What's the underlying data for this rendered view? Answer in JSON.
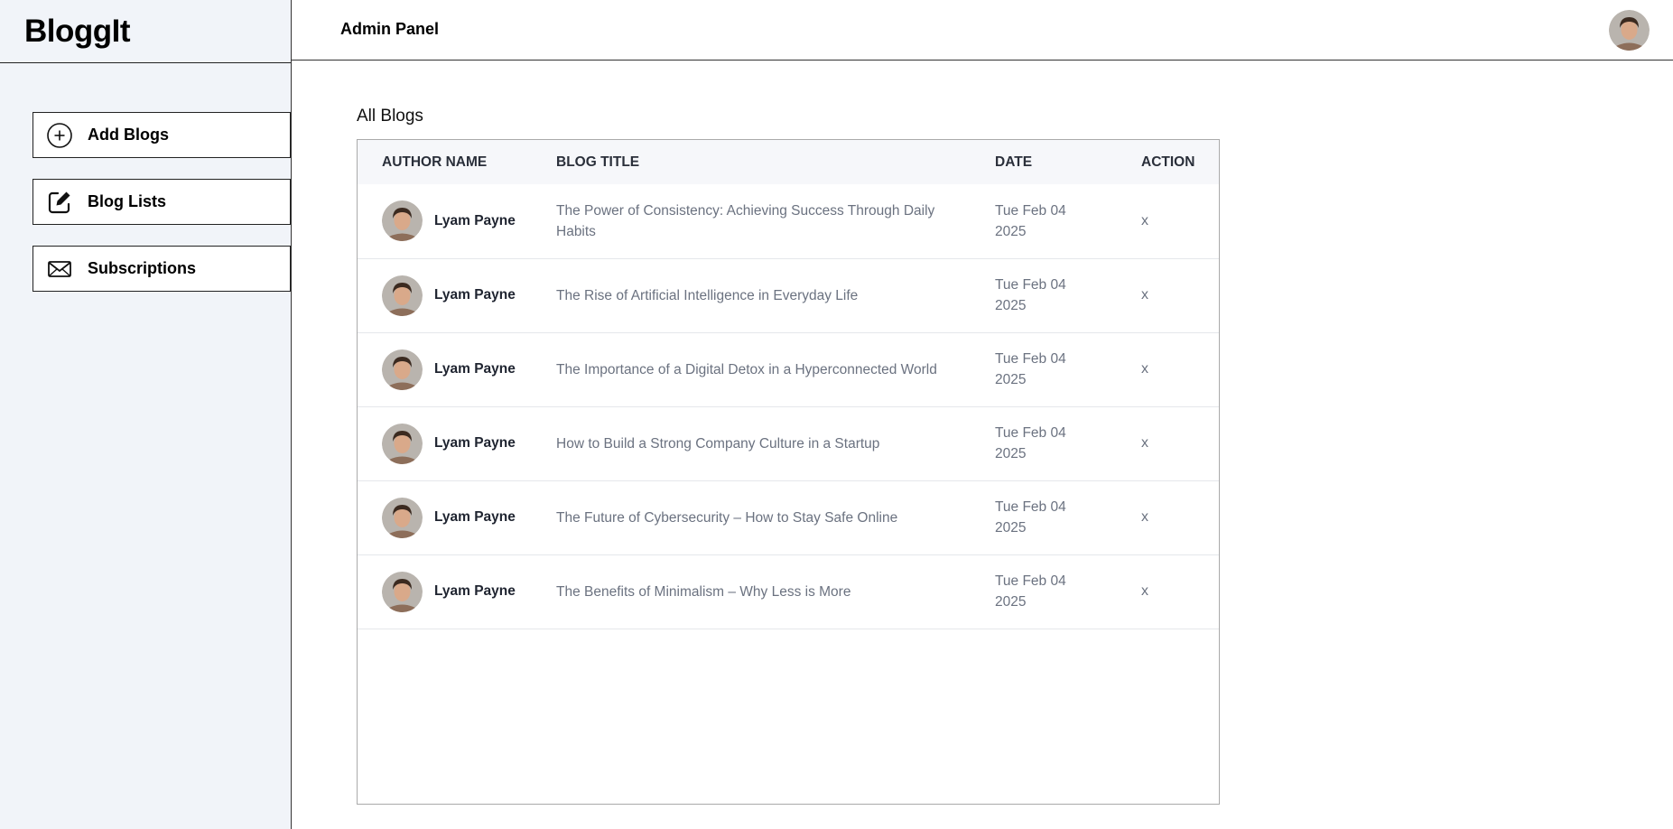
{
  "app": {
    "brand": "BloggIt",
    "header_title": "Admin Panel"
  },
  "sidebar": {
    "items": [
      {
        "label": "Add Blogs",
        "icon": "plus-circle-icon"
      },
      {
        "label": "Blog Lists",
        "icon": "edit-icon"
      },
      {
        "label": "Subscriptions",
        "icon": "mail-icon"
      }
    ]
  },
  "main": {
    "section_title": "All Blogs",
    "table": {
      "headers": [
        "AUTHOR NAME",
        "BLOG TITLE",
        "DATE",
        "ACTION"
      ],
      "rows": [
        {
          "author": "Lyam Payne",
          "title": "The Power of Consistency: Achieving Success Through Daily Habits",
          "date": "Tue Feb 04 2025",
          "action": "x"
        },
        {
          "author": "Lyam Payne",
          "title": "The Rise of Artificial Intelligence in Everyday Life",
          "date": "Tue Feb 04 2025",
          "action": "x"
        },
        {
          "author": "Lyam Payne",
          "title": "The Importance of a Digital Detox in a Hyperconnected World",
          "date": "Tue Feb 04 2025",
          "action": "x"
        },
        {
          "author": "Lyam Payne",
          "title": "How to Build a Strong Company Culture in a Startup",
          "date": "Tue Feb 04 2025",
          "action": "x"
        },
        {
          "author": "Lyam Payne",
          "title": "The Future of Cybersecurity – How to Stay Safe Online",
          "date": "Tue Feb 04 2025",
          "action": "x"
        },
        {
          "author": "Lyam Payne",
          "title": "The Benefits of Minimalism – Why Less is More",
          "date": "Tue Feb 04 2025",
          "action": "x"
        }
      ]
    }
  }
}
